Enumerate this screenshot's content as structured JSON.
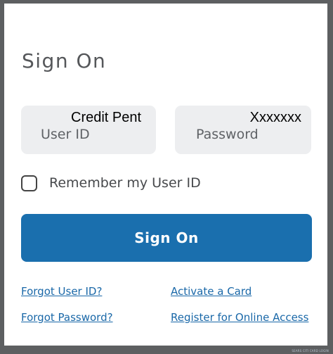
{
  "form": {
    "title": "Sign On",
    "user_id": {
      "typed_value": "Credit Pent",
      "placeholder": "User ID"
    },
    "password": {
      "typed_value": "Xxxxxxx",
      "placeholder": "Password"
    },
    "remember_label": "Remember my User ID",
    "remember_checked": false,
    "submit_label": "Sign On"
  },
  "links": {
    "forgot_user_id": "Forgot User ID?",
    "forgot_password": "Forgot Password?",
    "activate_card": "Activate a Card",
    "register": "Register for Online Access"
  },
  "footer": {
    "brand": "SEARS CITI CARD LOGIN"
  },
  "colors": {
    "background": "#5d5f61",
    "card": "#ffffff",
    "field": "#edeef0",
    "primary_button": "#1a6fae",
    "link": "#1a68a8"
  }
}
